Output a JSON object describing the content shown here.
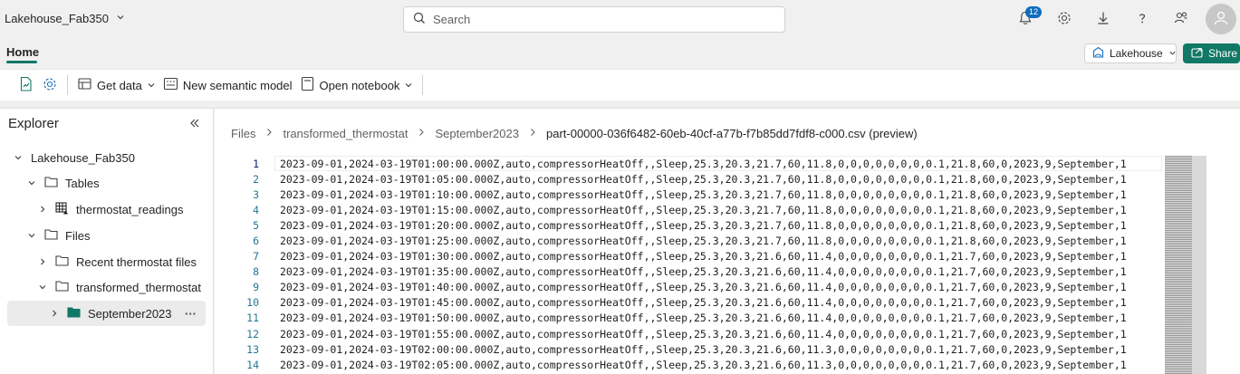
{
  "topbar": {
    "workspace_title": "Lakehouse_Fab350",
    "search_placeholder": "Search",
    "notification_count": "12"
  },
  "tabs": {
    "home_label": "Home"
  },
  "header_buttons": {
    "lakehouse_label": "Lakehouse",
    "share_label": "Share"
  },
  "ribbon": {
    "get_data_label": "Get data",
    "new_semantic_model_label": "New semantic model",
    "open_notebook_label": "Open notebook"
  },
  "explorer": {
    "title": "Explorer",
    "lakehouse_name": "Lakehouse_Fab350",
    "tables_label": "Tables",
    "table_item": "thermostat_readings",
    "files_label": "Files",
    "folder_recent": "Recent thermostat files",
    "folder_transformed": "transformed_thermostat",
    "folder_selected": "September2023",
    "more_label": "···"
  },
  "breadcrumb": {
    "items": [
      "Files",
      "transformed_thermostat",
      "September2023"
    ],
    "current": "part-00000-036f6482-60eb-40cf-a77b-f7b85dd7fdf8-c000.csv (preview)"
  },
  "preview": {
    "lines": [
      {
        "num": "1",
        "text": "2023-09-01,2024-03-19T01:00:00.000Z,auto,compressorHeatOff,,Sleep,25.3,20.3,21.7,60,11.8,0,0,0,0,0,0,0,0.1,21.8,60,0,2023,9,September,1"
      },
      {
        "num": "2",
        "text": "2023-09-01,2024-03-19T01:05:00.000Z,auto,compressorHeatOff,,Sleep,25.3,20.3,21.7,60,11.8,0,0,0,0,0,0,0,0.1,21.8,60,0,2023,9,September,1"
      },
      {
        "num": "3",
        "text": "2023-09-01,2024-03-19T01:10:00.000Z,auto,compressorHeatOff,,Sleep,25.3,20.3,21.7,60,11.8,0,0,0,0,0,0,0,0.1,21.8,60,0,2023,9,September,1"
      },
      {
        "num": "4",
        "text": "2023-09-01,2024-03-19T01:15:00.000Z,auto,compressorHeatOff,,Sleep,25.3,20.3,21.7,60,11.8,0,0,0,0,0,0,0,0.1,21.8,60,0,2023,9,September,1"
      },
      {
        "num": "5",
        "text": "2023-09-01,2024-03-19T01:20:00.000Z,auto,compressorHeatOff,,Sleep,25.3,20.3,21.7,60,11.8,0,0,0,0,0,0,0,0.1,21.8,60,0,2023,9,September,1"
      },
      {
        "num": "6",
        "text": "2023-09-01,2024-03-19T01:25:00.000Z,auto,compressorHeatOff,,Sleep,25.3,20.3,21.7,60,11.8,0,0,0,0,0,0,0,0.1,21.8,60,0,2023,9,September,1"
      },
      {
        "num": "7",
        "text": "2023-09-01,2024-03-19T01:30:00.000Z,auto,compressorHeatOff,,Sleep,25.3,20.3,21.6,60,11.4,0,0,0,0,0,0,0,0.1,21.7,60,0,2023,9,September,1"
      },
      {
        "num": "8",
        "text": "2023-09-01,2024-03-19T01:35:00.000Z,auto,compressorHeatOff,,Sleep,25.3,20.3,21.6,60,11.4,0,0,0,0,0,0,0,0.1,21.7,60,0,2023,9,September,1"
      },
      {
        "num": "9",
        "text": "2023-09-01,2024-03-19T01:40:00.000Z,auto,compressorHeatOff,,Sleep,25.3,20.3,21.6,60,11.4,0,0,0,0,0,0,0,0.1,21.7,60,0,2023,9,September,1"
      },
      {
        "num": "10",
        "text": "2023-09-01,2024-03-19T01:45:00.000Z,auto,compressorHeatOff,,Sleep,25.3,20.3,21.6,60,11.4,0,0,0,0,0,0,0,0.1,21.7,60,0,2023,9,September,1"
      },
      {
        "num": "11",
        "text": "2023-09-01,2024-03-19T01:50:00.000Z,auto,compressorHeatOff,,Sleep,25.3,20.3,21.6,60,11.4,0,0,0,0,0,0,0,0.1,21.7,60,0,2023,9,September,1"
      },
      {
        "num": "12",
        "text": "2023-09-01,2024-03-19T01:55:00.000Z,auto,compressorHeatOff,,Sleep,25.3,20.3,21.6,60,11.4,0,0,0,0,0,0,0,0.1,21.7,60,0,2023,9,September,1"
      },
      {
        "num": "13",
        "text": "2023-09-01,2024-03-19T02:00:00.000Z,auto,compressorHeatOff,,Sleep,25.3,20.3,21.6,60,11.3,0,0,0,0,0,0,0,0.1,21.7,60,0,2023,9,September,1"
      },
      {
        "num": "14",
        "text": "2023-09-01,2024-03-19T02:05:00.000Z,auto,compressorHeatOff,,Sleep,25.3,20.3,21.6,60,11.3,0,0,0,0,0,0,0,0.1,21.7,60,0,2023,9,September,1"
      }
    ]
  },
  "icons": {
    "workspace": "chevron-down-icon",
    "search": "search-icon",
    "notifications": "bell-icon",
    "settings": "gear-icon",
    "download": "download-icon",
    "help": "help-icon",
    "share_people": "people-icon",
    "avatar": "user-icon",
    "ribbon_new_file": "new-item-icon",
    "ribbon_settings": "gear-icon",
    "get_data": "database-icon",
    "semantic_model": "model-icon",
    "notebook": "notebook-icon",
    "collapse": "collapse-icon",
    "folder": "folder-icon",
    "table": "table-icon"
  },
  "colors": {
    "accent": "#117865",
    "line_number": "#237893",
    "badge": "#0f6cbd"
  }
}
